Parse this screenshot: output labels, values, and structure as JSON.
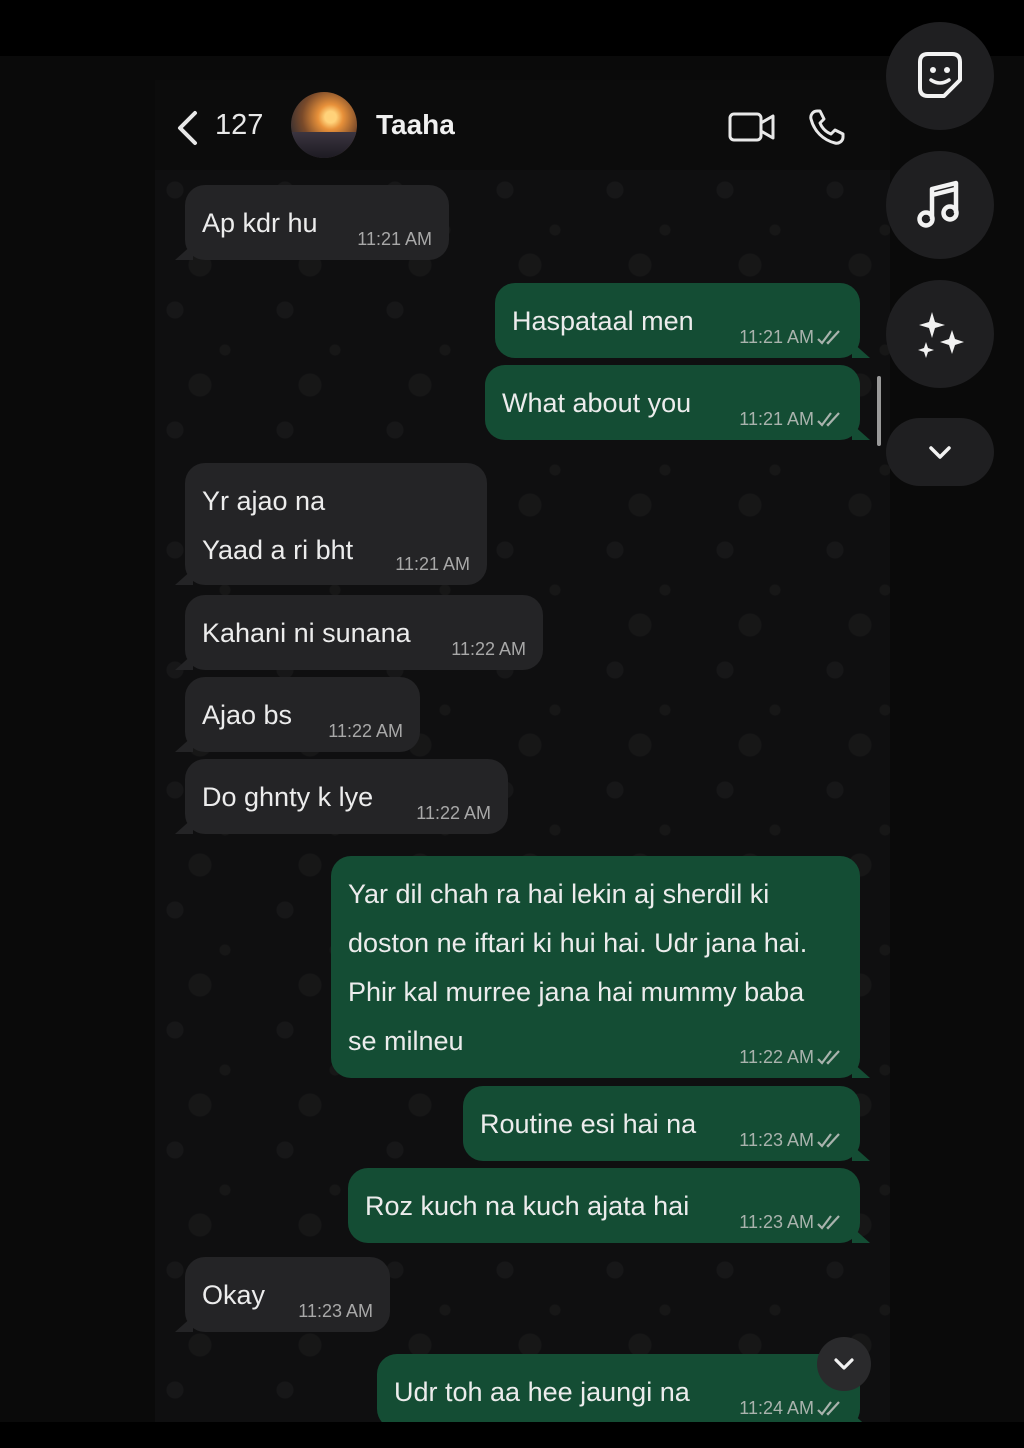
{
  "header": {
    "unread_count": "127",
    "contact_name": "Taaha"
  },
  "messages": [
    {
      "direction": "in",
      "lines": [
        "Ap kdr hu"
      ],
      "time": "11:21 AM"
    },
    {
      "direction": "out",
      "lines": [
        "Haspataal men"
      ],
      "time": "11:21 AM",
      "status": "read"
    },
    {
      "direction": "out",
      "lines": [
        "What about you"
      ],
      "time": "11:21 AM",
      "status": "read"
    },
    {
      "direction": "in",
      "lines": [
        "Yr ajao na",
        "Yaad a ri bht"
      ],
      "time": "11:21 AM"
    },
    {
      "direction": "in",
      "lines": [
        "Kahani ni sunana"
      ],
      "time": "11:22 AM"
    },
    {
      "direction": "in",
      "lines": [
        "Ajao bs"
      ],
      "time": "11:22 AM"
    },
    {
      "direction": "in",
      "lines": [
        "Do ghnty k lye"
      ],
      "time": "11:22 AM"
    },
    {
      "direction": "out",
      "lines": [
        "Yar dil chah ra hai lekin aj sherdil ki",
        "doston ne iftari ki hui hai. Udr jana hai.",
        "Phir kal murree jana hai mummy baba",
        "se milneu"
      ],
      "time": "11:22 AM",
      "status": "read"
    },
    {
      "direction": "out",
      "lines": [
        "Routine esi hai na"
      ],
      "time": "11:23 AM",
      "status": "read"
    },
    {
      "direction": "out",
      "lines": [
        "Roz kuch na kuch ajata hai"
      ],
      "time": "11:23 AM",
      "status": "read"
    },
    {
      "direction": "in",
      "lines": [
        "Okay"
      ],
      "time": "11:23 AM"
    },
    {
      "direction": "out",
      "lines": [
        "Udr toh aa hee jaungi na"
      ],
      "time": "11:24 AM",
      "status": "read"
    }
  ],
  "icons": {
    "back": "chevron-left-icon",
    "video": "video-camera-icon",
    "call": "phone-icon",
    "sticker": "sticker-icon",
    "music": "music-note-icon",
    "effects": "sparkles-icon",
    "scroll_down": "chevron-down-icon"
  },
  "colors": {
    "incoming_bubble": "#242426",
    "outgoing_bubble": "#144d34",
    "background": "#0f0f10",
    "text": "#ececec"
  }
}
